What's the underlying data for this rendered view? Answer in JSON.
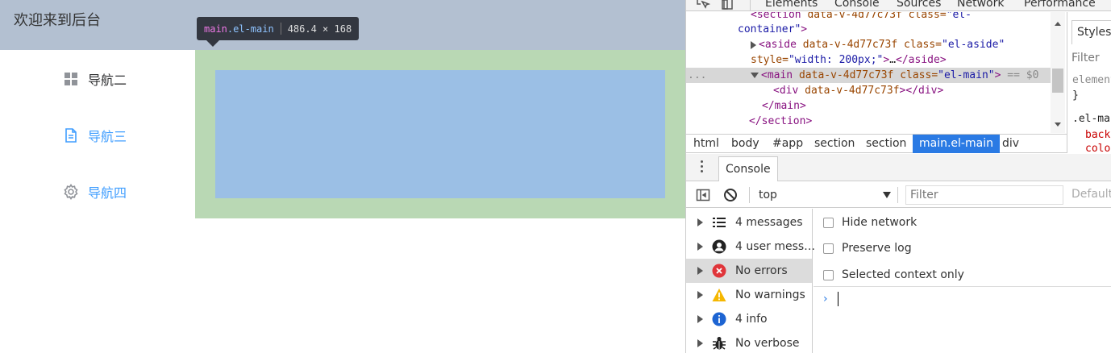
{
  "app": {
    "header_title": "欢迎来到后台",
    "nav": [
      {
        "label": "导航二",
        "icon": "grid-icon"
      },
      {
        "label": "导航三",
        "icon": "document-icon"
      },
      {
        "label": "导航四",
        "icon": "gear-icon"
      }
    ],
    "tooltip": {
      "tag": "main",
      "class": ".el-main",
      "size": "486.4 × 168"
    },
    "colors": {
      "header": "#b3c0d1",
      "main": "#b9d8b4",
      "inner": "#9bbfe5",
      "active": "#409eff"
    }
  },
  "devtools": {
    "tabs": [
      "Elements",
      "Console",
      "Sources",
      "Network",
      "Performance"
    ],
    "elements": {
      "line0": {
        "tag_open": "<",
        "tag": "section",
        "attr": " data-v-4d77c73f",
        "attr2": " class=",
        "val": "\"el-"
      },
      "line1": {
        "val": "container\"",
        "tag_close": ">"
      },
      "line2": {
        "tag": "<aside",
        "attr": " data-v-4d77c73f",
        "attr2": " class=",
        "val": "\"el-aside\""
      },
      "line3": {
        "attr": "style=",
        "val": "\"width: 200px;\"",
        "tag": ">",
        "txt": "…",
        "tag_end": "</aside>"
      },
      "line4": {
        "dots": "...",
        "tag": "<main",
        "attr": " data-v-4d77c73f",
        "attr2": " class=",
        "val": "\"el-main\"",
        "tag_close": ">",
        "eq": " == $0"
      },
      "line5": {
        "tag": "<div",
        "attr": " data-v-4d77c73f",
        "tag_close": "></div>"
      },
      "line6": {
        "tag": "</main>"
      },
      "line7": {
        "tag": "</section>"
      }
    },
    "breadcrumbs": [
      "html",
      "body",
      "#app",
      "section",
      "section",
      "main.el-main",
      "div"
    ],
    "styles": {
      "tab": "Styles",
      "filter": "Filter",
      "lines": [
        "element",
        "}",
        ".el-ma",
        "back",
        "colo"
      ]
    },
    "drawer_tab": "Console",
    "console_toolbar": {
      "context": "top",
      "filter_placeholder": "Filter",
      "levels": "Default"
    },
    "sidebar": [
      {
        "label": "4 messages",
        "icon": "list-icon"
      },
      {
        "label": "4 user mess…",
        "icon": "user-icon"
      },
      {
        "label": "No errors",
        "icon": "error-icon"
      },
      {
        "label": "No warnings",
        "icon": "warning-icon"
      },
      {
        "label": "4 info",
        "icon": "info-icon"
      },
      {
        "label": "No verbose",
        "icon": "bug-icon"
      }
    ],
    "settings": [
      "Hide network",
      "Preserve log",
      "Selected context only"
    ],
    "prompt": "›"
  }
}
